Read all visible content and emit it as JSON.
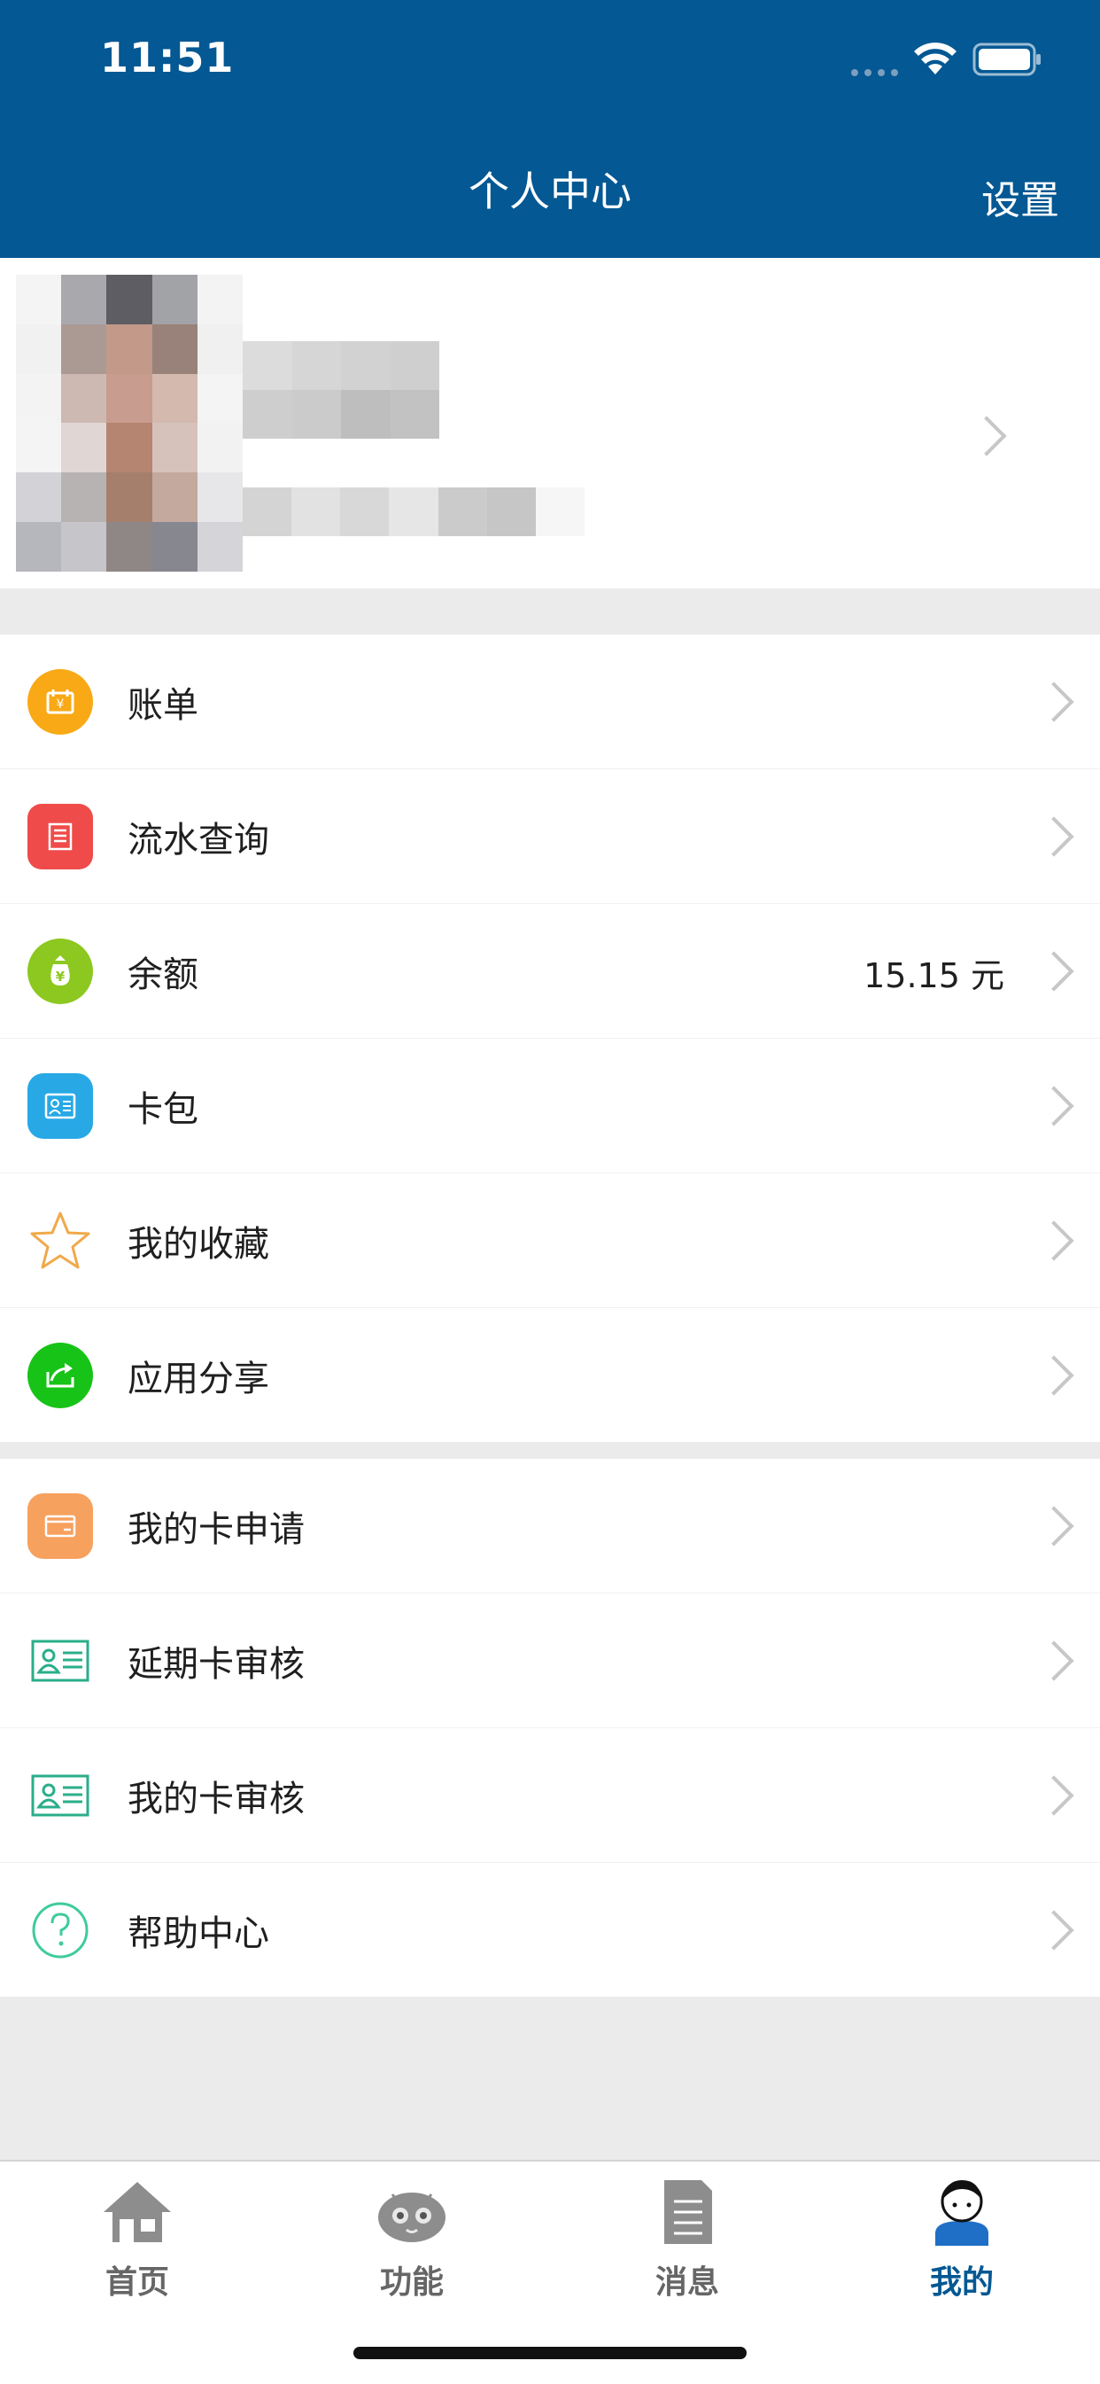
{
  "status_bar": {
    "time": "11:51"
  },
  "nav": {
    "title": "个人中心",
    "settings_label": "设置"
  },
  "menu_group_1": [
    {
      "label": "账单",
      "icon": "bill-icon",
      "color": "#F8A915"
    },
    {
      "label": "流水查询",
      "icon": "transaction-query-icon",
      "color": "#EF4B4B"
    },
    {
      "label": "余额",
      "icon": "money-bag-icon",
      "color": "#8CC820",
      "value": "15.15 元"
    },
    {
      "label": "卡包",
      "icon": "card-wallet-icon",
      "color": "#28A9E6"
    },
    {
      "label": "我的收藏",
      "icon": "star-icon",
      "color": "#F0A94A"
    },
    {
      "label": "应用分享",
      "icon": "share-icon",
      "color": "#17C317"
    }
  ],
  "menu_group_2": [
    {
      "label": "我的卡申请",
      "icon": "card-application-icon",
      "color": "#F7A15E"
    },
    {
      "label": "延期卡审核",
      "icon": "id-card-icon",
      "color": "#2AAE8A"
    },
    {
      "label": "我的卡审核",
      "icon": "id-card-icon",
      "color": "#2AAE8A"
    },
    {
      "label": "帮助中心",
      "icon": "help-icon",
      "color": "#3FCB9B"
    }
  ],
  "tabbar": {
    "tabs": [
      {
        "label": "首页",
        "icon": "home-icon"
      },
      {
        "label": "功能",
        "icon": "robot-icon"
      },
      {
        "label": "消息",
        "icon": "document-icon"
      },
      {
        "label": "我的",
        "icon": "user-icon",
        "active": true
      }
    ],
    "active_color": "#045893"
  }
}
